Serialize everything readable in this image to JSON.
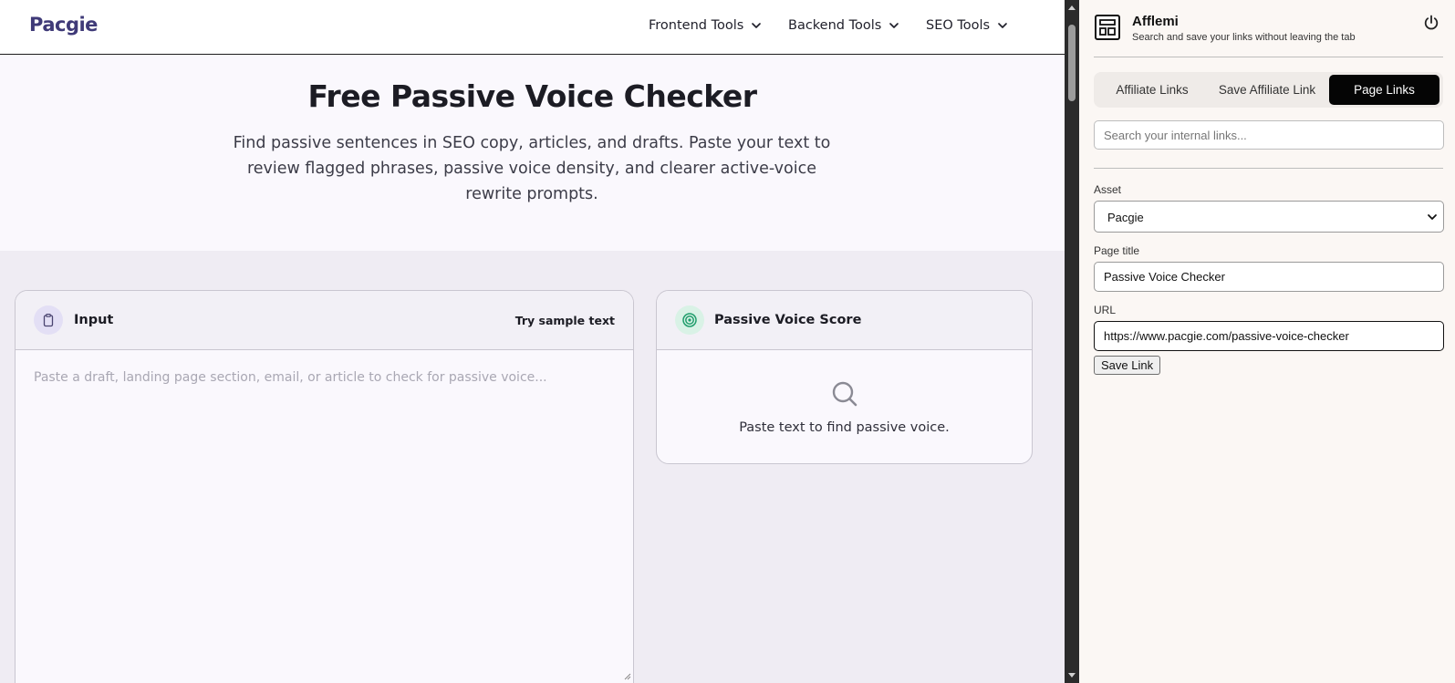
{
  "site": {
    "logo": "Pacgie",
    "nav": [
      {
        "label": "Frontend Tools"
      },
      {
        "label": "Backend Tools"
      },
      {
        "label": "SEO Tools"
      }
    ]
  },
  "hero": {
    "title": "Free Passive Voice Checker",
    "subtitle": "Find passive sentences in SEO copy, articles, and drafts. Paste your text to review flagged phrases, passive voice density, and clearer active-voice rewrite prompts."
  },
  "input_card": {
    "title": "Input",
    "icon": "clipboard-icon",
    "sample_link": "Try sample text",
    "placeholder": "Paste a draft, landing page section, email, or article to check for passive voice...",
    "value": ""
  },
  "score_card": {
    "title": "Passive Voice Score",
    "icon": "target-icon",
    "empty_icon": "search-icon",
    "empty_text": "Paste text to find passive voice."
  },
  "extension": {
    "name": "Afflemi",
    "tagline": "Search and save your links without leaving the tab",
    "logo_icon": "layout-icon",
    "power_icon": "power-icon",
    "tabs": [
      {
        "label": "Affiliate Links",
        "active": false
      },
      {
        "label": "Save Affiliate Link",
        "active": false
      },
      {
        "label": "Page Links",
        "active": true
      }
    ],
    "search_placeholder": "Search your internal links...",
    "form": {
      "asset_label": "Asset",
      "asset_value": "Pacgie",
      "page_title_label": "Page title",
      "page_title_value": "Passive Voice Checker",
      "url_label": "URL",
      "url_value": "https://www.pacgie.com/passive-voice-checker",
      "save_label": "Save Link"
    }
  },
  "colors": {
    "brand": "#3f3a78",
    "active_tab": "#050505",
    "score_icon": "#1f9d6b",
    "input_icon_bg": "#e3dff5"
  }
}
